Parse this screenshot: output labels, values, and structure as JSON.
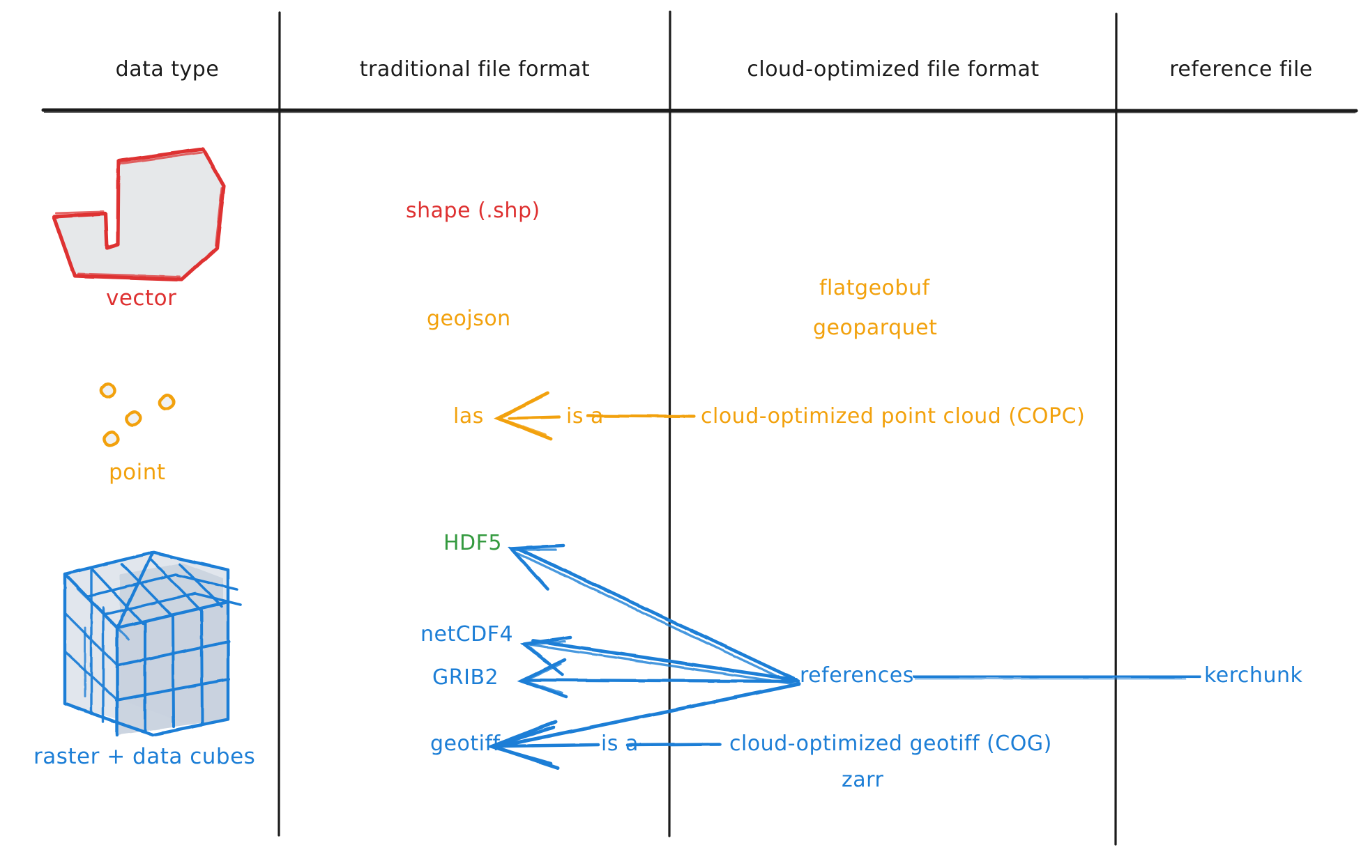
{
  "diagram": {
    "title": "geospatial data type to file format mapping",
    "colors": {
      "red": "#DE3030",
      "orange": "#F2A10C",
      "blue": "#1C7ED6",
      "green": "#349A3F",
      "black": "#1b1b1b",
      "fill_gray": "#E6E8EA",
      "cube_fill": "#C8D2DE"
    },
    "columns": [
      {
        "id": "data-type",
        "label": "data type"
      },
      {
        "id": "traditional",
        "label": "traditional file format"
      },
      {
        "id": "cloud-optimized",
        "label": "cloud-optimized file format"
      },
      {
        "id": "reference",
        "label": "reference file"
      }
    ],
    "data_types": [
      {
        "id": "vector",
        "label": "vector",
        "color": "#DE3030",
        "icon": "polygon-icon"
      },
      {
        "id": "point",
        "label": "point",
        "color": "#F2A10C",
        "icon": "points-icon"
      },
      {
        "id": "raster",
        "label": "raster + data cubes",
        "color": "#1C7ED6",
        "icon": "data-cube-icon"
      }
    ],
    "traditional_formats": [
      {
        "id": "shape",
        "label": "shape (.shp)",
        "color": "#DE3030"
      },
      {
        "id": "geojson",
        "label": "geojson",
        "color": "#F2A10C"
      },
      {
        "id": "las",
        "label": "las",
        "color": "#F2A10C"
      },
      {
        "id": "hdf5",
        "label": "HDF5",
        "color": "#349A3F"
      },
      {
        "id": "netcdf4",
        "label": "netCDF4",
        "color": "#1C7ED6"
      },
      {
        "id": "grib2",
        "label": "GRIB2",
        "color": "#1C7ED6"
      },
      {
        "id": "geotiff",
        "label": "geotiff",
        "color": "#1C7ED6"
      }
    ],
    "cloud_optimized_formats": [
      {
        "id": "flatgeobuf",
        "label": "flatgeobuf",
        "color": "#F2A10C"
      },
      {
        "id": "geoparquet",
        "label": "geoparquet",
        "color": "#F2A10C"
      },
      {
        "id": "copc",
        "label": "cloud-optimized point cloud (COPC)",
        "color": "#F2A10C"
      },
      {
        "id": "references",
        "label": "references",
        "color": "#1C7ED6"
      },
      {
        "id": "cog",
        "label": "cloud-optimized geotiff (COG)",
        "color": "#1C7ED6"
      },
      {
        "id": "zarr",
        "label": "zarr",
        "color": "#1C7ED6"
      }
    ],
    "reference_files": [
      {
        "id": "kerchunk",
        "label": "kerchunk",
        "color": "#1C7ED6"
      }
    ],
    "edge_labels": [
      {
        "id": "is-a-copc",
        "label": "is a",
        "color": "#F2A10C"
      },
      {
        "id": "is-a-cog",
        "label": "is a",
        "color": "#1C7ED6"
      }
    ],
    "relations": [
      {
        "from": "copc",
        "to": "las",
        "label": "is a"
      },
      {
        "from": "cog",
        "to": "geotiff",
        "label": "is a"
      },
      {
        "from": "references",
        "to": "hdf5",
        "label": ""
      },
      {
        "from": "references",
        "to": "netcdf4",
        "label": ""
      },
      {
        "from": "references",
        "to": "grib2",
        "label": ""
      },
      {
        "from": "references",
        "to": "geotiff",
        "label": ""
      },
      {
        "from": "kerchunk",
        "to": "references",
        "label": ""
      }
    ]
  }
}
